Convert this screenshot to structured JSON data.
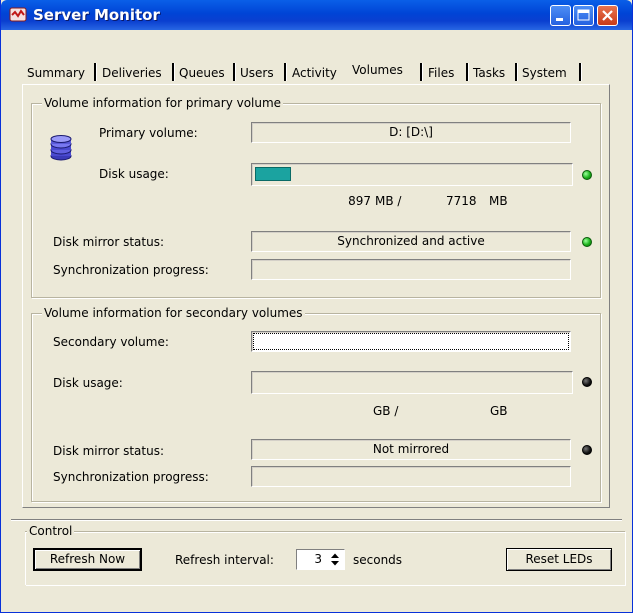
{
  "window": {
    "title": "Server Monitor",
    "titlebar_color": "#0a4fd8"
  },
  "tabs": [
    {
      "label": "Summary",
      "active": false
    },
    {
      "label": "Deliveries",
      "active": false
    },
    {
      "label": "Queues",
      "active": false
    },
    {
      "label": "Users",
      "active": false
    },
    {
      "label": "Activity",
      "active": false
    },
    {
      "label": "Volumes",
      "active": true
    },
    {
      "label": "Files",
      "active": false
    },
    {
      "label": "Tasks",
      "active": false
    },
    {
      "label": "System",
      "active": false
    }
  ],
  "primary": {
    "group_title": "Volume information for primary volume",
    "volume_label": "Primary volume:",
    "volume_value": "D: [D:\\]",
    "disk_icon": "disk-stack-icon",
    "usage_label": "Disk usage:",
    "usage_fraction": 0.116,
    "used": "897",
    "used_unit": "MB /",
    "total": "7718",
    "total_unit": "MB",
    "usage_led": "green",
    "mirror_label": "Disk mirror status:",
    "mirror_value": "Synchronized and active",
    "mirror_led": "green",
    "sync_label": "Synchronization progress:",
    "sync_value": ""
  },
  "secondary": {
    "group_title": "Volume information for secondary volumes",
    "volume_label": "Secondary volume:",
    "volume_value": "",
    "usage_label": "Disk usage:",
    "used_unit": "GB /",
    "total_unit": "GB",
    "usage_led": "black",
    "mirror_label": "Disk mirror status:",
    "mirror_value": "Not mirrored",
    "mirror_led": "black",
    "sync_label": "Synchronization progress:",
    "sync_value": ""
  },
  "control": {
    "group_title": "Control",
    "refresh_button": "Refresh Now",
    "interval_label": "Refresh interval:",
    "interval_value": "3",
    "interval_unit": "seconds",
    "reset_button": "Reset LEDs"
  },
  "colors": {
    "window_bg": "#ece9d8",
    "usage_bar": "#1ba3a0",
    "led_green": "#1cb21c",
    "led_off": "#000000"
  }
}
